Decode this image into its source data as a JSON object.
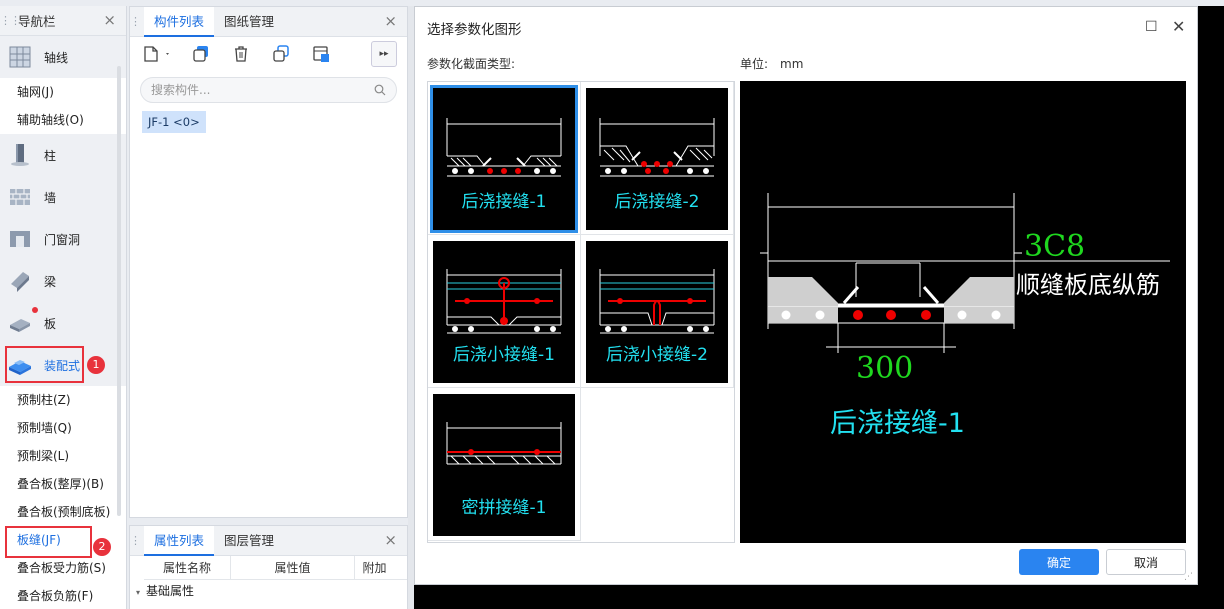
{
  "nav": {
    "title": "导航栏",
    "groups": {
      "axis": "轴线",
      "column": "柱",
      "wall": "墙",
      "opening": "门窗洞",
      "beam": "梁",
      "slab": "板",
      "prefab": "装配式"
    },
    "axis_items": [
      "轴网(J)",
      "辅助轴线(O)"
    ],
    "prefab_items": [
      "预制柱(Z)",
      "预制墙(Q)",
      "预制梁(L)",
      "叠合板(整厚)(B)",
      "叠合板(预制底板)",
      "板缝(JF)",
      "叠合板受力筋(S)",
      "叠合板负筋(F)"
    ],
    "badges": [
      "1",
      "2"
    ]
  },
  "component_panel": {
    "tabs": [
      "构件列表",
      "图纸管理"
    ],
    "search_placeholder": "搜索构件...",
    "items": [
      "JF-1 <0>"
    ]
  },
  "property_panel": {
    "tabs": [
      "属性列表",
      "图层管理"
    ],
    "columns": [
      "属性名称",
      "属性值",
      "附加"
    ],
    "group": "基础属性"
  },
  "dialog": {
    "title": "选择参数化图形",
    "type_label": "参数化截面类型:",
    "unit_label": "单位:",
    "unit_value": "mm",
    "shapes": [
      "后浇接缝-1",
      "后浇接缝-2",
      "后浇小接缝-1",
      "后浇小接缝-2",
      "密拼接缝-1"
    ],
    "selected_index": 0,
    "preview": {
      "rebar_spec": "3C8",
      "rebar_desc": "顺缝板底纵筋",
      "width": "300",
      "name": "后浇接缝-1"
    },
    "ok_label": "确定",
    "cancel_label": "取消"
  },
  "colors": {
    "accent": "#2a84f0",
    "highlight": "#e8323c",
    "cad_cyan": "#22e0f0",
    "cad_green": "#1fd81f"
  }
}
